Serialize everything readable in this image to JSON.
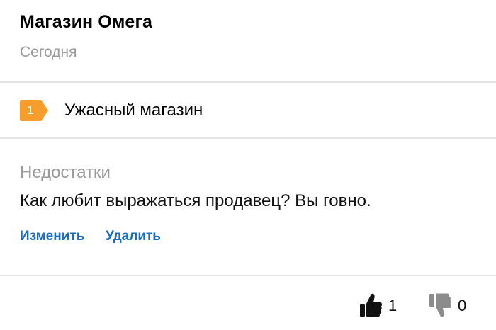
{
  "review": {
    "shop_name": "Магазин Омега",
    "date": "Сегодня",
    "rating": {
      "value": "1",
      "badge_color": "#f79d2c",
      "title": "Ужасный магазин"
    },
    "cons": {
      "label": "Недостатки",
      "text": "Как любит выражаться продавец? Вы говно."
    },
    "actions": {
      "edit_label": "Изменить",
      "delete_label": "Удалить"
    },
    "votes": {
      "likes": "1",
      "dislikes": "0",
      "like_icon": "thumbs-up-icon",
      "dislike_icon": "thumbs-down-icon"
    }
  },
  "colors": {
    "link": "#1a6dc6",
    "muted_text": "#9a9a9a",
    "divider": "#e4e4e4",
    "like_icon": "#111111",
    "dislike_icon": "#8c8c8c"
  }
}
